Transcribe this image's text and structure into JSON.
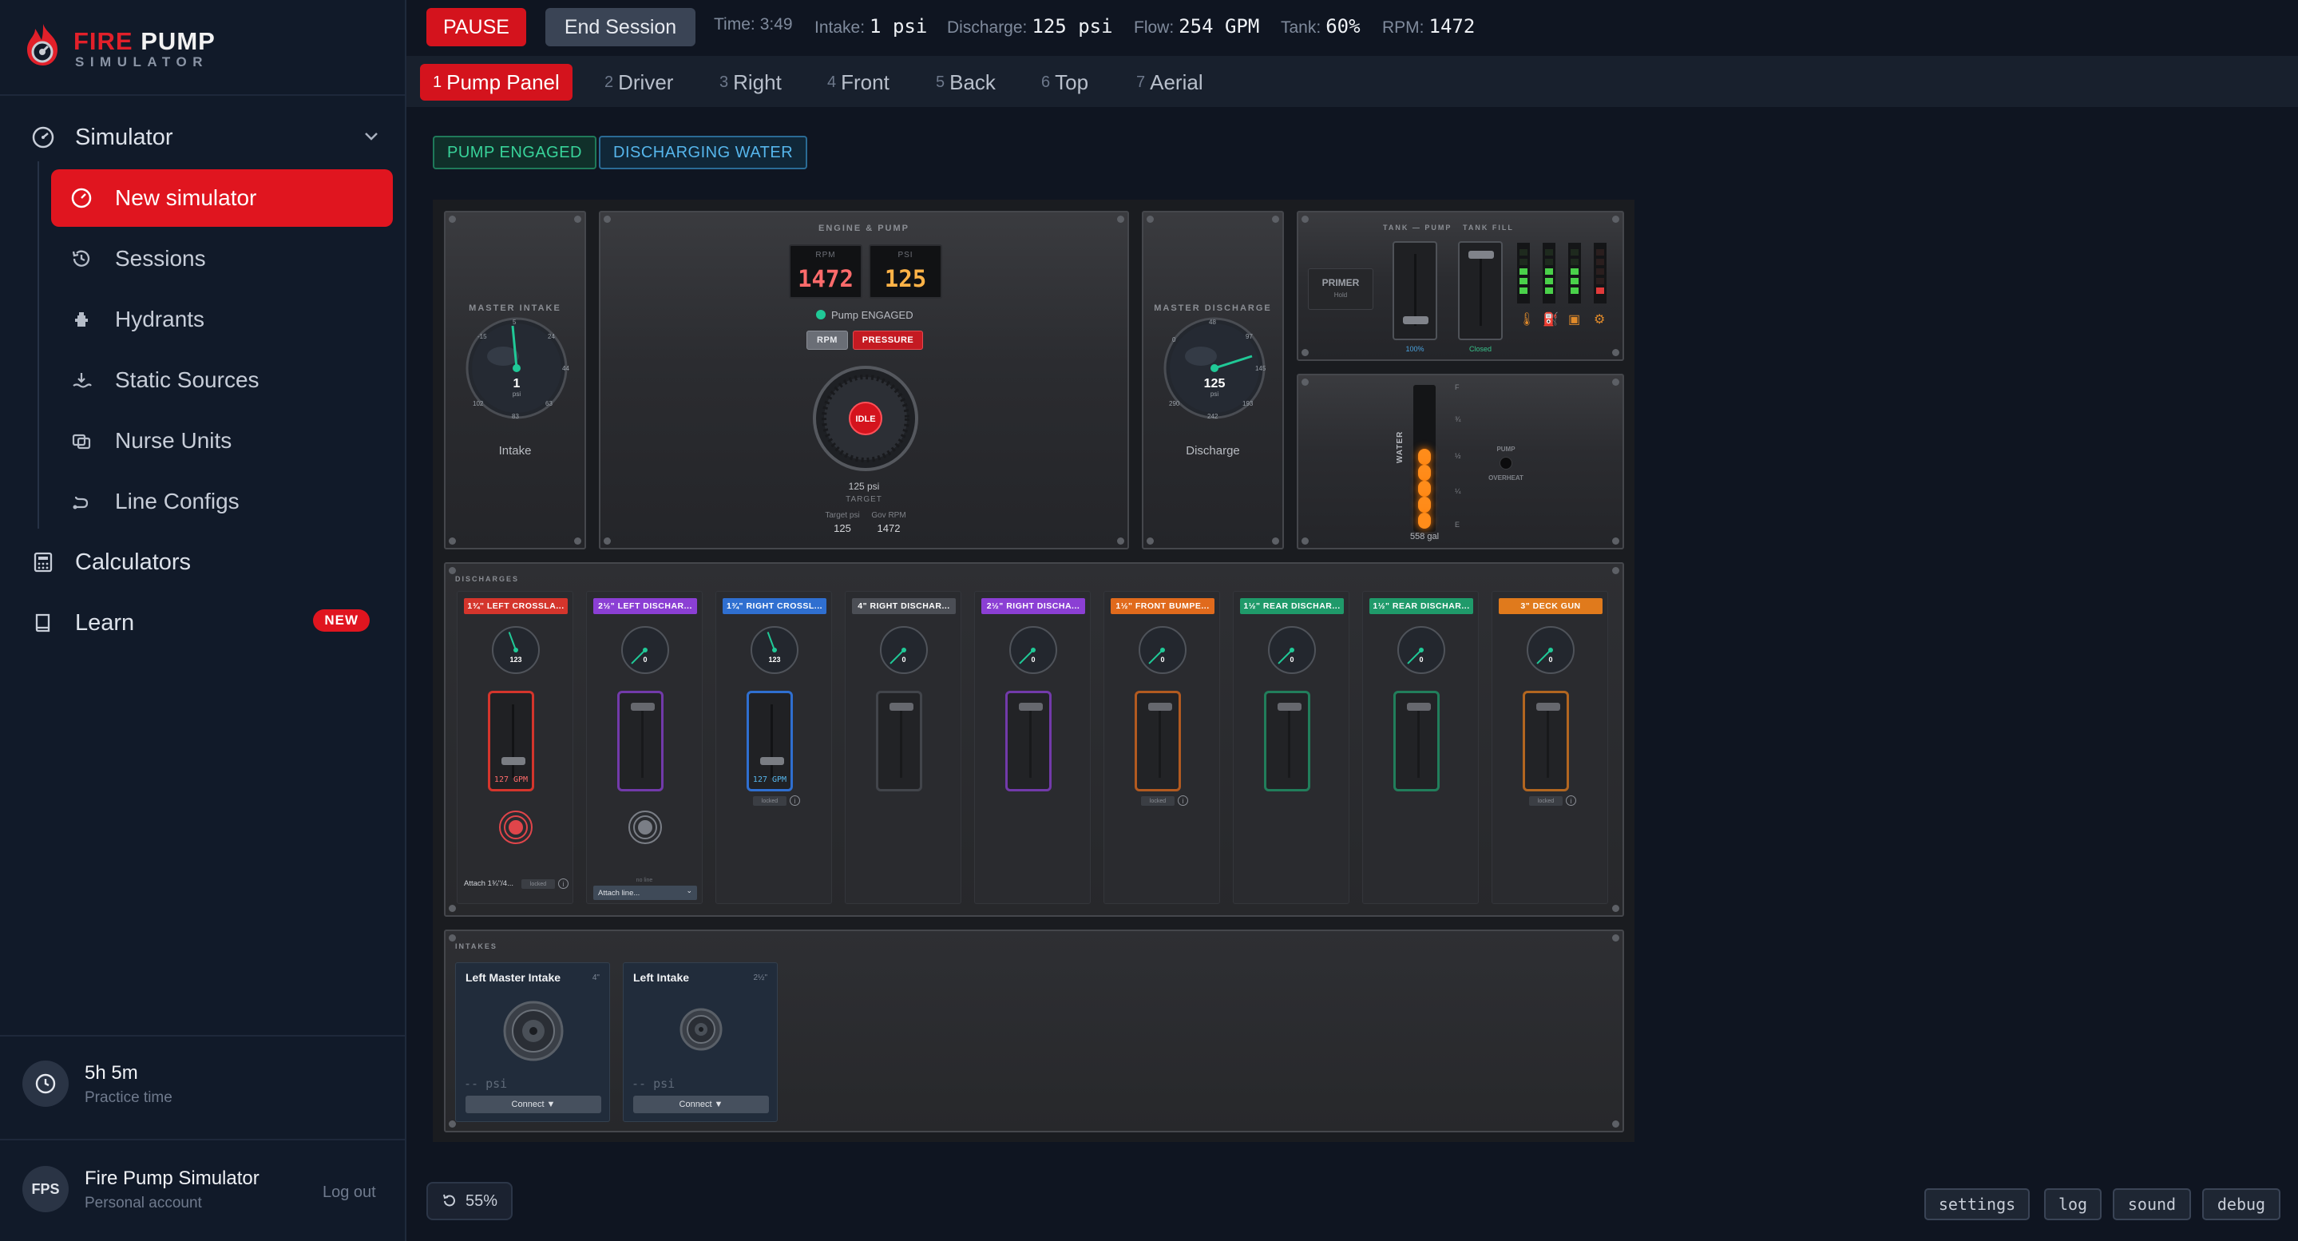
{
  "brand": {
    "line1_red": "FIRE",
    "line1_white": "PUMP",
    "line2": "SIMULATOR"
  },
  "sidebar": {
    "group": "Simulator",
    "items": [
      {
        "label": "New simulator",
        "icon": "gauge-icon",
        "active": true
      },
      {
        "label": "Sessions",
        "icon": "history-icon"
      },
      {
        "label": "Hydrants",
        "icon": "hydrant-icon"
      },
      {
        "label": "Static Sources",
        "icon": "water-source-icon"
      },
      {
        "label": "Nurse Units",
        "icon": "nurse-unit-icon"
      },
      {
        "label": "Line Configs",
        "icon": "route-icon"
      }
    ],
    "calculators": "Calculators",
    "learn": "Learn",
    "learn_badge": "NEW",
    "practice_value": "5h 5m",
    "practice_label": "Practice time",
    "account_initials": "FPS",
    "account_name": "Fire Pump Simulator",
    "account_type": "Personal account",
    "logout": "Log out"
  },
  "topbar": {
    "pause": "PAUSE",
    "end_session": "End Session",
    "time_label": "Time:",
    "time_value": "3:49",
    "intake_label": "Intake:",
    "intake_value": "1 psi",
    "discharge_label": "Discharge:",
    "discharge_value": "125 psi",
    "flow_label": "Flow:",
    "flow_value": "254 GPM",
    "tank_label": "Tank:",
    "tank_value": "60%",
    "rpm_label": "RPM:",
    "rpm_value": "1472"
  },
  "tabs": [
    {
      "num": "1",
      "label": "Pump Panel",
      "active": true
    },
    {
      "num": "2",
      "label": "Driver"
    },
    {
      "num": "3",
      "label": "Right"
    },
    {
      "num": "4",
      "label": "Front"
    },
    {
      "num": "5",
      "label": "Back"
    },
    {
      "num": "6",
      "label": "Top"
    },
    {
      "num": "7",
      "label": "Aerial"
    }
  ],
  "status": {
    "pump": "PUMP ENGAGED",
    "water": "DISCHARGING WATER"
  },
  "panel": {
    "master_intake": {
      "title": "MASTER INTAKE",
      "value": "1",
      "unit": "psi",
      "label": "Intake",
      "ticks": [
        "-5",
        "5",
        "24",
        "44",
        "63",
        "83",
        "102",
        "-15"
      ]
    },
    "engine": {
      "title": "ENGINE & PUMP",
      "rpm_label": "RPM",
      "rpm_value": "1472",
      "psi_label": "PSI",
      "psi_value": "125",
      "status": "Pump ENGAGED",
      "mode_rpm": "RPM",
      "mode_pressure": "PRESSURE",
      "idle": "IDLE",
      "target": "125 psi",
      "target_label": "TARGET",
      "target_psi_label": "Target psi",
      "target_psi": "125",
      "gov_rpm_label": "Gov RPM",
      "gov_rpm": "1472"
    },
    "master_discharge": {
      "title": "MASTER DISCHARGE",
      "value": "125",
      "unit": "psi",
      "label": "Discharge",
      "ticks": [
        "0",
        "48",
        "97",
        "145",
        "193",
        "242",
        "290"
      ]
    },
    "tank": {
      "title1": "TANK — PUMP",
      "title2": "TANK FILL",
      "primer": "PRIMER",
      "primer_sub": "Hold",
      "tank_to_pump": "100%",
      "tank_fill": "Closed",
      "water_label": "WATER",
      "gallons": "558 gal",
      "levels": [
        "F",
        "¾",
        "½",
        "¼",
        "E"
      ],
      "pump_label": "PUMP",
      "overheat": "OVERHEAT"
    },
    "discharges_title": "DISCHARGES",
    "discharges": [
      {
        "label": "1¾\" LEFT CROSSLA...",
        "color": "#d4352c",
        "psi": "123",
        "gpm": "127 GPM",
        "open": true,
        "knob": "red",
        "footer": "Attach 1¾\"/4...",
        "badge": "locked",
        "handle_frac": 0.82
      },
      {
        "label": "2½\" LEFT DISCHAR...",
        "color": "#8b3fd4",
        "psi": "0",
        "gpm": "",
        "open": false,
        "knob": "gray",
        "footer_hint": "no line",
        "select": "Attach line...",
        "handle_frac": 0.05
      },
      {
        "label": "1¾\" RIGHT CROSSL...",
        "color": "#2f6fd0",
        "psi": "123",
        "gpm": "127 GPM",
        "open": true,
        "badge": "locked",
        "handle_frac": 0.82
      },
      {
        "label": "4\" RIGHT DISCHAR...",
        "color": "#4b4e55",
        "psi": "0",
        "gpm": "",
        "open": false,
        "handle_frac": 0.05
      },
      {
        "label": "2½\" RIGHT DISCHA...",
        "color": "#8b3fd4",
        "psi": "0",
        "gpm": "",
        "open": false,
        "handle_frac": 0.05
      },
      {
        "label": "1½\" FRONT BUMPE...",
        "color": "#e06a1c",
        "psi": "0",
        "gpm": "",
        "open": false,
        "badge": "locked",
        "handle_frac": 0.05
      },
      {
        "label": "1½\" REAR DISCHAR...",
        "color": "#1f9a6a",
        "psi": "0",
        "gpm": "",
        "open": false,
        "handle_frac": 0.05
      },
      {
        "label": "1½\" REAR DISCHAR...",
        "color": "#1f9a6a",
        "psi": "0",
        "gpm": "",
        "open": false,
        "handle_frac": 0.05
      },
      {
        "label": "3\" DECK GUN",
        "color": "#e07a1c",
        "psi": "0",
        "gpm": "",
        "open": false,
        "badge": "locked",
        "handle_frac": 0.05
      }
    ],
    "intakes_title": "INTAKES",
    "intakes": [
      {
        "title": "Left Master Intake",
        "size": "4\"",
        "psi": "-- psi",
        "button": "Connect ▼"
      },
      {
        "title": "Left Intake",
        "size": "2½\"",
        "psi": "-- psi",
        "button": "Connect ▼"
      }
    ]
  },
  "bottom": {
    "zoom": "55%",
    "settings": "settings",
    "log": "log",
    "sound": "sound",
    "debug": "debug"
  },
  "colors": {
    "brand_red": "#e0151f",
    "green": "#38d39a",
    "blue": "#56b6ec"
  }
}
